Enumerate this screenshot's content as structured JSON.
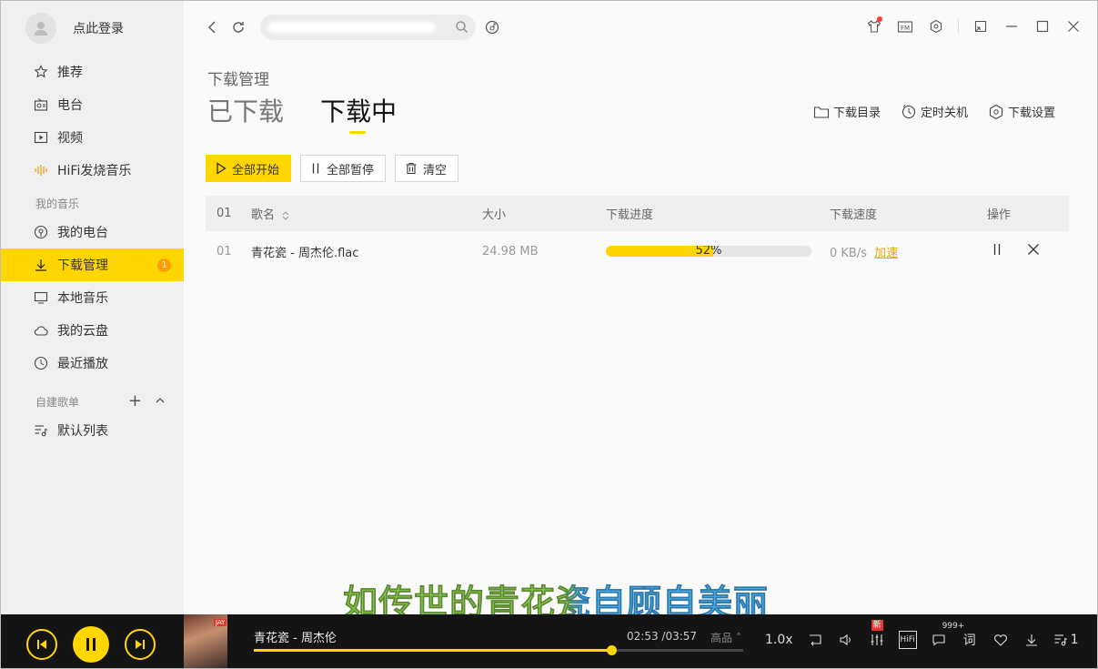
{
  "sidebar": {
    "login_text": "点此登录",
    "items_top": [
      {
        "label": "推荐",
        "icon": "star-icon"
      },
      {
        "label": "电台",
        "icon": "radio-icon"
      },
      {
        "label": "视频",
        "icon": "video-icon"
      },
      {
        "label": "HiFi发烧音乐",
        "icon": "soundwave-icon"
      }
    ],
    "my_music_title": "我的音乐",
    "items_my": [
      {
        "label": "我的电台",
        "icon": "podcast-icon"
      },
      {
        "label": "下载管理",
        "icon": "download-icon",
        "badge": "1",
        "active": true
      },
      {
        "label": "本地音乐",
        "icon": "monitor-icon"
      },
      {
        "label": "我的云盘",
        "icon": "cloud-icon"
      },
      {
        "label": "最近播放",
        "icon": "clock-icon"
      }
    ],
    "playlist_title": "自建歌单",
    "playlist_items": [
      {
        "label": "默认列表",
        "icon": "playlist-icon"
      }
    ]
  },
  "topbar": {
    "search_placeholder": "",
    "icons": [
      "back-icon",
      "refresh-icon",
      "search-icon",
      "recognize-icon",
      "skin-icon",
      "fm-icon",
      "settings-icon",
      "mini-mode-icon",
      "maximize-icon",
      "close-icon"
    ]
  },
  "page": {
    "breadcrumb": "下载管理",
    "tabs": [
      {
        "label": "已下载",
        "active": false
      },
      {
        "label": "下载中",
        "active": true
      }
    ],
    "actions": [
      {
        "label": "下载目录",
        "icon": "folder-icon"
      },
      {
        "label": "定时关机",
        "icon": "timer-icon"
      },
      {
        "label": "下载设置",
        "icon": "hex-settings-icon"
      }
    ],
    "buttons": {
      "start_all": "全部开始",
      "pause_all": "全部暂停",
      "clear": "清空"
    }
  },
  "table": {
    "headers": {
      "index": "01",
      "name": "歌名",
      "size": "大小",
      "progress": "下载进度",
      "speed": "下载速度",
      "ops": "操作"
    },
    "rows": [
      {
        "index": "01",
        "name": "青花瓷 - 周杰伦.flac",
        "size": "24.98 MB",
        "progress": 0.52,
        "progress_label": "52%",
        "speed": "0 KB/s",
        "boost": "加速"
      }
    ]
  },
  "lyric": "如传世的青花瓷自顾自美丽",
  "player": {
    "song": "青花瓷 - 周杰伦",
    "cover_tag": "JAY",
    "time": "02:53 /03:57",
    "quality": "高品",
    "progress": 0.73,
    "speed_label": "1.0x",
    "hifi_label": "HiFi",
    "new_tag": "新",
    "comments": "999+",
    "lyrics_btn": "词",
    "queue_count": "1"
  },
  "colors": {
    "accent": "#ffd600",
    "player_bg": "#141414",
    "badge": "#ff9c00"
  }
}
